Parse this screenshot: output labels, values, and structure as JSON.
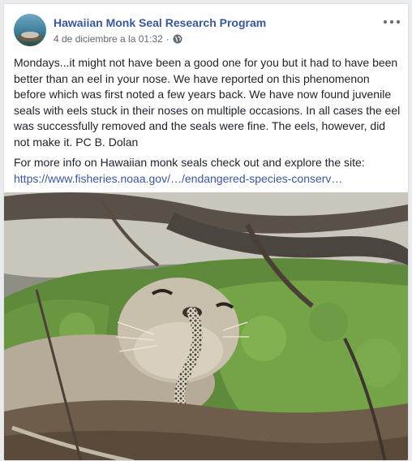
{
  "post": {
    "page_name": "Hawaiian Monk Seal Research Program",
    "timestamp": "4 de diciembre a la 01:32",
    "separator": "·",
    "privacy_icon": "globe-icon",
    "options_icon": "more-options-icon",
    "body": "Mondays...it might not have been a good one for you but it had to have been better than an eel in your nose. We have reported on this phenomenon before which was first noted a few years back. We have now found juvenile seals with eels stuck in their noses on multiple occasions. In all cases the eel was successfully removed and the seals were fine. The eels, however, did not make it. PC B. Dolan",
    "more_info": "For more info on Hawaiian monk seals check out and explore the site:",
    "link": "https://www.fisheries.noaa.gov/…/endangered-species-conserv…"
  },
  "colors": {
    "link": "#385898",
    "text": "#1d2129",
    "meta": "#616770",
    "background": "#e9ebee"
  }
}
